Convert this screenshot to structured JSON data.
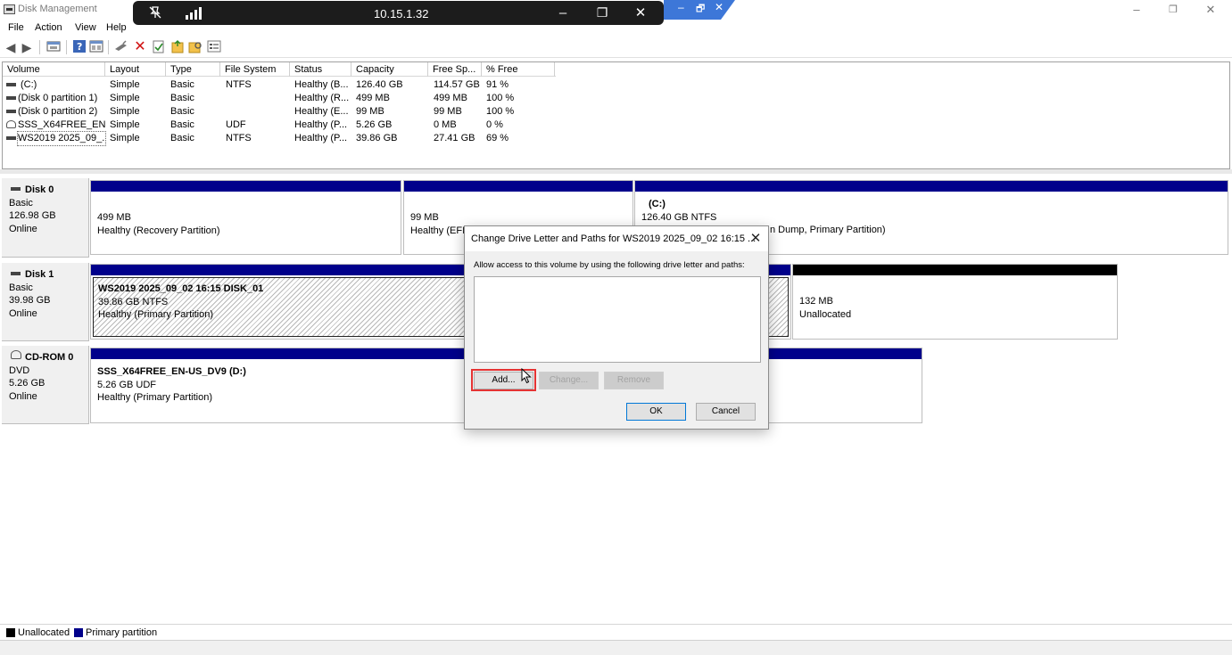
{
  "window": {
    "title": "Disk Management",
    "controls": {
      "minimize": "–",
      "restore": "❐",
      "close": "✕"
    }
  },
  "remote_bar": {
    "host": "10.15.1.32",
    "icons": [
      "pin-off-icon",
      "signal-icon",
      "minimize-icon",
      "restore-icon",
      "close-icon"
    ],
    "minimize": "–",
    "restore": "❐",
    "close": "✕",
    "tail_minimize": "–",
    "tail_restore": "🗗",
    "tail_close": "✕"
  },
  "menu": [
    "File",
    "Action",
    "View",
    "Help"
  ],
  "toolbar_icons": [
    "back-icon",
    "forward-icon",
    "console-tree-icon",
    "help-icon",
    "properties-icon",
    "connect-icon",
    "delete-icon",
    "check-icon",
    "folder-icon",
    "search-folder-icon",
    "list-icon"
  ],
  "volume_list": {
    "headers": [
      "Volume",
      "Layout",
      "Type",
      "File System",
      "Status",
      "Capacity",
      "Free Sp...",
      "% Free"
    ],
    "rows": [
      {
        "icon": "drive-icon",
        "volume": "(C:)",
        "layout": "Simple",
        "type": "Basic",
        "fs": "NTFS",
        "status": "Healthy (B...",
        "capacity": "126.40 GB",
        "free": "114.57 GB",
        "pct": "91 %"
      },
      {
        "icon": "drive-icon",
        "volume": "(Disk 0 partition 1)",
        "layout": "Simple",
        "type": "Basic",
        "fs": "",
        "status": "Healthy (R...",
        "capacity": "499 MB",
        "free": "499 MB",
        "pct": "100 %"
      },
      {
        "icon": "drive-icon",
        "volume": "(Disk 0 partition 2)",
        "layout": "Simple",
        "type": "Basic",
        "fs": "",
        "status": "Healthy (E...",
        "capacity": "99 MB",
        "free": "99 MB",
        "pct": "100 %"
      },
      {
        "icon": "cd-icon",
        "volume": "SSS_X64FREE_EN-...",
        "layout": "Simple",
        "type": "Basic",
        "fs": "UDF",
        "status": "Healthy (P...",
        "capacity": "5.26 GB",
        "free": "0 MB",
        "pct": "0 %"
      },
      {
        "icon": "drive-icon",
        "volume": "WS2019 2025_09_...",
        "layout": "Simple",
        "type": "Basic",
        "fs": "NTFS",
        "status": "Healthy (P...",
        "capacity": "39.86 GB",
        "free": "27.41 GB",
        "pct": "69 %"
      }
    ]
  },
  "disks": {
    "disk0": {
      "name": "Disk 0",
      "type": "Basic",
      "size": "126.98 GB",
      "state": "Online",
      "parts": [
        {
          "l1": "499 MB",
          "l2": "Healthy (Recovery Partition)"
        },
        {
          "l1": "99 MB",
          "l2": "Healthy (EFI S"
        },
        {
          "title": "(C:)",
          "l1": "126.40 GB NTFS",
          "l2": "n Dump, Primary Partition)"
        }
      ]
    },
    "disk1": {
      "name": "Disk 1",
      "type": "Basic",
      "size": "39.98 GB",
      "state": "Online",
      "parts": [
        {
          "title": "WS2019 2025_09_02 16:15 DISK_01",
          "l1": "39.86 GB NTFS",
          "l2": "Healthy (Primary Partition)"
        },
        {
          "l1": "132 MB",
          "l2": "Unallocated"
        }
      ]
    },
    "cdrom0": {
      "name": "CD-ROM 0",
      "type": "DVD",
      "size": "5.26 GB",
      "state": "Online",
      "parts": [
        {
          "title": "SSS_X64FREE_EN-US_DV9  (D:)",
          "l1": "5.26 GB UDF",
          "l2": "Healthy (Primary Partition)"
        }
      ]
    }
  },
  "legend": [
    {
      "label": "Unallocated",
      "color": "#000000"
    },
    {
      "label": "Primary partition",
      "color": "#00008b"
    }
  ],
  "dialog": {
    "title": "Change Drive Letter and Paths for WS2019 2025_09_02 16:15 ...",
    "description": "Allow access to this volume by using the following drive letter and paths:",
    "close": "✕",
    "buttons": {
      "add": "Add...",
      "change": "Change...",
      "remove": "Remove",
      "ok": "OK",
      "cancel": "Cancel"
    }
  }
}
